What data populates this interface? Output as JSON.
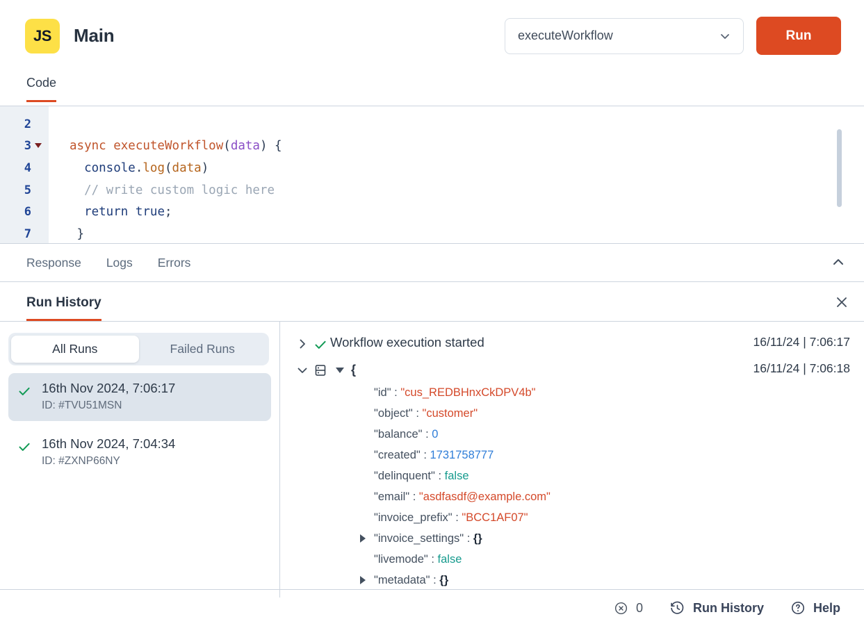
{
  "header": {
    "logo_text": "JS",
    "title": "Main",
    "function_select": {
      "value": "executeWorkflow",
      "icon": "chevron-down-icon"
    },
    "run_button": "Run",
    "accent_color": "#dd4a22",
    "logo_color": "#fde047"
  },
  "code_section": {
    "tab_label": "Code",
    "lines": [
      {
        "number": "2",
        "foldable": false,
        "tokens": []
      },
      {
        "number": "3",
        "foldable": true,
        "tokens": [
          {
            "t": "async ",
            "c": "tok-kw"
          },
          {
            "t": "executeWorkflow",
            "c": "tok-fn"
          },
          {
            "t": "(",
            "c": "tok-pun"
          },
          {
            "t": "data",
            "c": "tok-par"
          },
          {
            "t": ") {",
            "c": "tok-pun"
          }
        ]
      },
      {
        "number": "4",
        "foldable": false,
        "tokens": [
          {
            "t": "  ",
            "c": "tok-pun"
          },
          {
            "t": "console",
            "c": "tok-obj"
          },
          {
            "t": ".",
            "c": "tok-pun"
          },
          {
            "t": "log",
            "c": "tok-prop"
          },
          {
            "t": "(",
            "c": "tok-pun"
          },
          {
            "t": "data",
            "c": "tok-prop"
          },
          {
            "t": ")",
            "c": "tok-pun"
          }
        ]
      },
      {
        "number": "5",
        "foldable": false,
        "tokens": [
          {
            "t": "  // write custom logic here",
            "c": "tok-com"
          }
        ]
      },
      {
        "number": "6",
        "foldable": false,
        "tokens": [
          {
            "t": "  ",
            "c": "tok-pun"
          },
          {
            "t": "return",
            "c": "tok-obj"
          },
          {
            "t": " ",
            "c": "tok-pun"
          },
          {
            "t": "true",
            "c": "tok-bool"
          },
          {
            "t": ";",
            "c": "tok-pun"
          }
        ]
      },
      {
        "number": "7",
        "foldable": false,
        "tokens": [
          {
            "t": " }",
            "c": "tok-pun"
          }
        ]
      }
    ]
  },
  "result_tabs": {
    "items": [
      "Response",
      "Logs",
      "Errors"
    ],
    "collapse_icon": "chevron-up-icon"
  },
  "run_history": {
    "title": "Run History",
    "close_icon": "close-icon",
    "filter": {
      "options": [
        "All Runs",
        "Failed Runs"
      ],
      "selected": "All Runs"
    },
    "runs": [
      {
        "date": "16th Nov 2024, 7:06:17",
        "id": "ID: #TVU51MSN",
        "status": "success",
        "selected": true
      },
      {
        "date": "16th Nov 2024, 7:04:34",
        "id": "ID: #ZXNP66NY",
        "status": "success",
        "selected": false
      }
    ],
    "logs": [
      {
        "caret": "chevron-right-icon",
        "status": "check-icon",
        "text": "Workflow execution started",
        "time": "16/11/24 | 7:06:17"
      },
      {
        "caret": "chevron-down-icon",
        "status": "table-icon",
        "text": "{",
        "time": "16/11/24 | 7:06:18"
      }
    ],
    "json_payload": [
      {
        "key": "\"id\"",
        "value": "\"cus_REDBHnxCkDPV4b\"",
        "type": "string",
        "expandable": false
      },
      {
        "key": "\"object\"",
        "value": "\"customer\"",
        "type": "string",
        "expandable": false
      },
      {
        "key": "\"balance\"",
        "value": "0",
        "type": "number",
        "expandable": false
      },
      {
        "key": "\"created\"",
        "value": "1731758777",
        "type": "number",
        "expandable": false
      },
      {
        "key": "\"delinquent\"",
        "value": "false",
        "type": "boolean",
        "expandable": false
      },
      {
        "key": "\"email\"",
        "value": "\"asdfasdf@example.com\"",
        "type": "string",
        "expandable": false
      },
      {
        "key": "\"invoice_prefix\"",
        "value": "\"BCC1AF07\"",
        "type": "string",
        "expandable": false
      },
      {
        "key": "\"invoice_settings\"",
        "value": "{}",
        "type": "empty",
        "expandable": true
      },
      {
        "key": "\"livemode\"",
        "value": "false",
        "type": "boolean",
        "expandable": false
      },
      {
        "key": "\"metadata\"",
        "value": "{}",
        "type": "empty",
        "expandable": true
      }
    ]
  },
  "status_bar": {
    "error_count": "0",
    "error_icon": "error-circle-icon",
    "run_history_label": "Run History",
    "run_history_icon": "history-clock-icon",
    "help_label": "Help",
    "help_icon": "help-circle-icon"
  }
}
